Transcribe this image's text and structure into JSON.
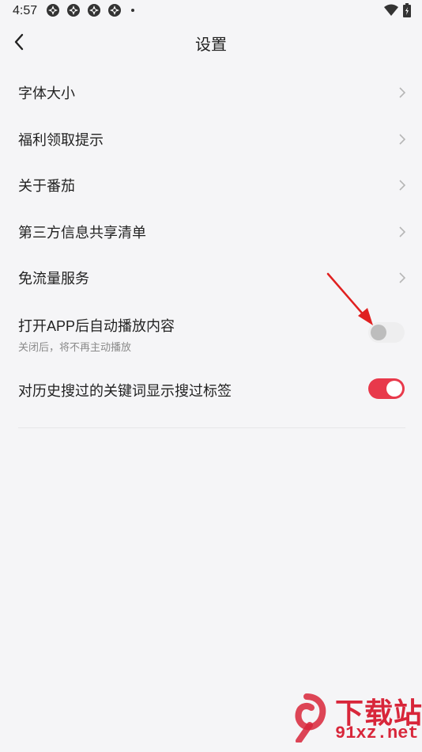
{
  "status_bar": {
    "time": "4:57",
    "left_icons": [
      "app-notification-icon",
      "app-notification-icon",
      "app-notification-icon",
      "app-notification-icon"
    ],
    "right_icons": [
      "wifi-icon",
      "battery-icon"
    ]
  },
  "header": {
    "title": "设置",
    "back_icon": "chevron-left-icon"
  },
  "settings": {
    "items": [
      {
        "label": "字体大小"
      },
      {
        "label": "福利领取提示"
      },
      {
        "label": "关于番茄"
      },
      {
        "label": "第三方信息共享清单"
      },
      {
        "label": "免流量服务"
      }
    ],
    "toggles": [
      {
        "label": "打开APP后自动播放内容",
        "subtitle": "关闭后，将不再主动播放",
        "enabled": false
      },
      {
        "label": "对历史搜过的关键词显示搜过标签",
        "enabled": true
      }
    ]
  },
  "colors": {
    "accent": "#e8394b",
    "background": "#f5f5f7",
    "annotation_arrow": "#e02020"
  },
  "watermark": {
    "brand_text": "下载站",
    "domain": "91xz.net"
  }
}
